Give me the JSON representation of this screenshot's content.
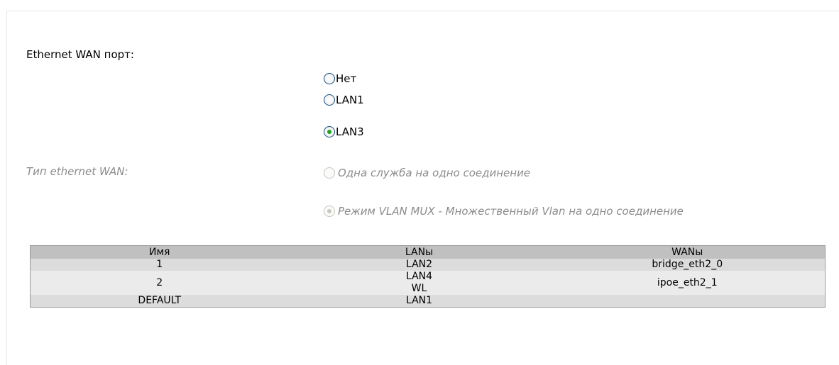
{
  "wan_port": {
    "label": "Ethernet WAN порт:",
    "options": [
      {
        "label": "Нет",
        "checked": false
      },
      {
        "label": "LAN1",
        "checked": false
      },
      {
        "label": "LAN3",
        "checked": true
      }
    ]
  },
  "wan_type": {
    "label": "Тип ethernet WAN:",
    "disabled": true,
    "options": [
      {
        "label": "Одна служба на одно соединение",
        "checked": false
      },
      {
        "label": "Режим VLAN MUX - Множественный Vlan на одно соединение",
        "checked": true
      }
    ]
  },
  "table": {
    "headers": [
      "Имя",
      "LANы",
      "WANы"
    ],
    "rows": [
      {
        "name": "1",
        "lans": [
          "LAN2"
        ],
        "wans": "bridge_eth2_0"
      },
      {
        "name": "2",
        "lans": [
          "LAN4",
          "WL"
        ],
        "wans": "ipoe_eth2_1"
      },
      {
        "name": "DEFAULT",
        "lans": [
          "LAN1"
        ],
        "wans": ""
      }
    ]
  },
  "colors": {
    "header_bg": "#c0c0c0",
    "row_odd_bg": "#dcdcdc",
    "row_even_bg": "#ebebeb",
    "radio_checked": "#21a121",
    "disabled_text": "#8c8c8c"
  }
}
